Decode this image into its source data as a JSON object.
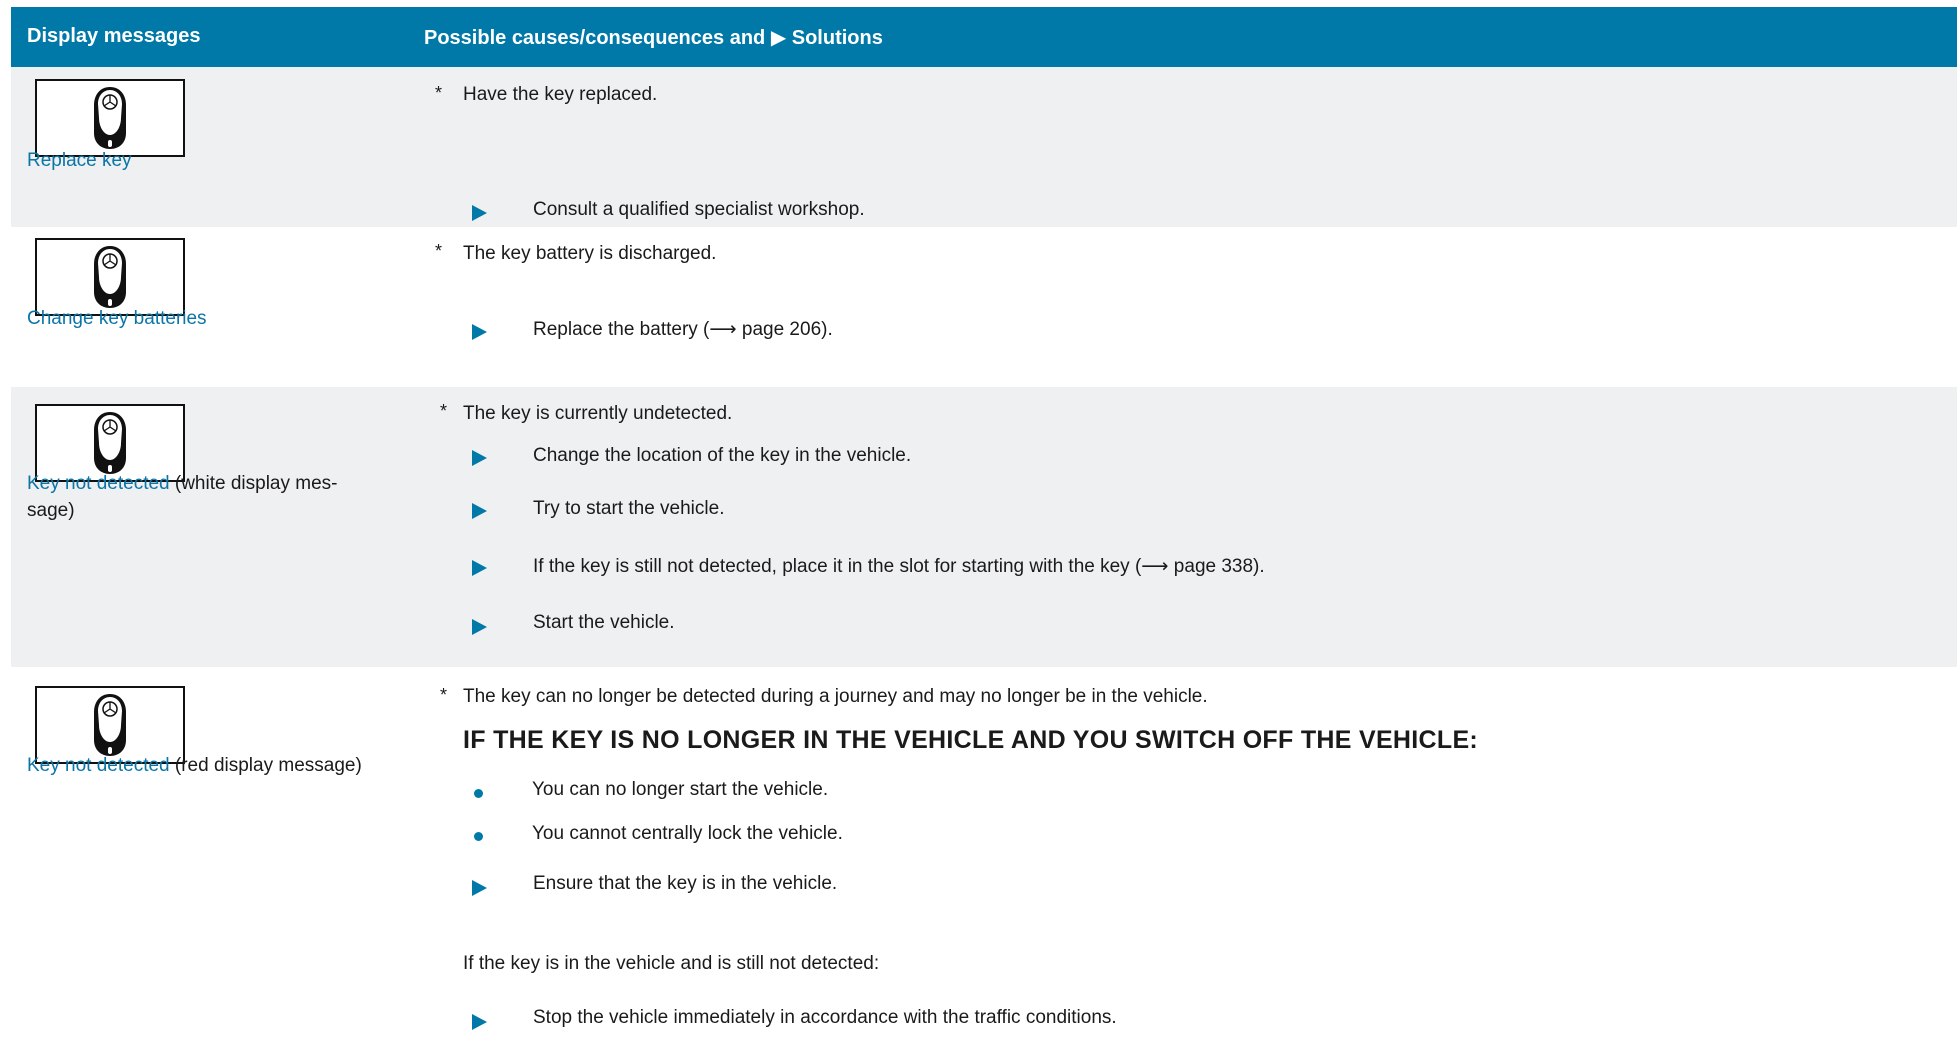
{
  "header": {
    "col1": "Display messages",
    "col2": "Possible causes/consequences and ▶ Solutions"
  },
  "rows": [
    {
      "label_link": "Replace key",
      "label_rest": "",
      "cause": "Have the key replaced.",
      "solutions": [
        "Consult a qualified specialist workshop."
      ]
    },
    {
      "label_link": "Change key batteries",
      "label_rest": "",
      "cause": "The key battery is discharged.",
      "solutions": [
        "Replace the battery (⟶ page 206)."
      ]
    },
    {
      "label_link": "Key not detected",
      "label_rest": " (white display mes-",
      "label_rest2": "sage)",
      "cause": "The key is currently undetected.",
      "solutions": [
        "Change the location of the key in the vehicle.",
        "Try to start the vehicle.",
        "If the key is still not detected, place it in the slot for starting with the key (⟶ page 338).",
        "Start the vehicle."
      ]
    },
    {
      "label_link": "Key not detected",
      "label_rest": " (red display message)",
      "cause": "The key can no longer be detected during a journey and may no longer be in the vehicle.",
      "warning_heading": "IF THE KEY IS NO LONGER IN THE VEHICLE AND YOU SWITCH OFF THE VEHICLE:",
      "bullets": [
        "You can no longer start the vehicle.",
        "You cannot centrally lock the vehicle."
      ],
      "solution1": "Ensure that the key is in the vehicle.",
      "note": "If the key is in the vehicle and is still not detected:",
      "solution2": "Stop the vehicle immediately in accordance with the traffic conditions."
    }
  ],
  "colors": {
    "header_bg": "#0079a8",
    "row_grey": "#eff0f2",
    "link": "#0b75a8",
    "accent": "#0079a8"
  },
  "icons": {
    "display_icon": "car-key-icon",
    "solution_marker": "triangle-right-icon",
    "cause_marker": "asterisk",
    "bullet_marker": "dot-bullet"
  }
}
